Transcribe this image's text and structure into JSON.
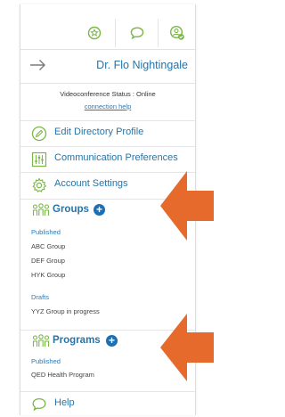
{
  "colors": {
    "accent": "#2874a6",
    "icon_green": "#7ab648",
    "plus_blue": "#1c6fb5",
    "callout_orange": "#e66a2c"
  },
  "topbar": {
    "icons": [
      "star-badge-icon",
      "chat-bubble-icon",
      "profile-check-icon"
    ]
  },
  "header": {
    "back_icon": "arrow-right-icon",
    "user_name": "Dr. Flo Nightingale"
  },
  "status": {
    "label": "Videoconference Status : Online",
    "help_link": "connection help"
  },
  "menu": [
    {
      "icon": "pencil-circle-icon",
      "label": "Edit Directory Profile"
    },
    {
      "icon": "sliders-icon",
      "label": "Communication Preferences"
    },
    {
      "icon": "gear-icon",
      "label": "Account Settings"
    }
  ],
  "groups": {
    "icon": "people-icon",
    "title": "Groups",
    "published_label": "Published",
    "published": [
      "ABC Group",
      "DEF Group",
      "HYK Group"
    ],
    "drafts_label": "Drafts",
    "drafts": [
      "YYZ Group in progress"
    ]
  },
  "programs": {
    "icon": "people-icon",
    "title": "Programs",
    "published_label": "Published",
    "published": [
      "QED Health Program"
    ]
  },
  "help": {
    "icon": "chat-bubble-icon",
    "label": "Help"
  }
}
